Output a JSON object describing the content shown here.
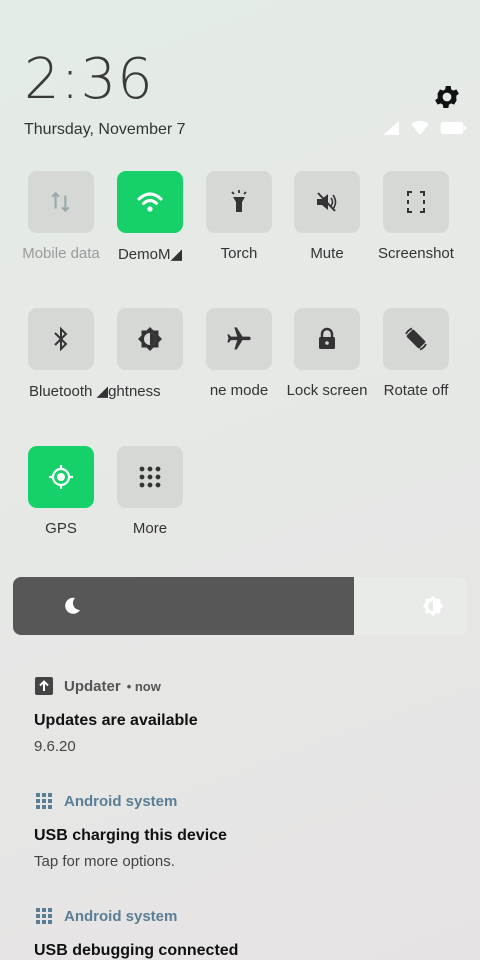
{
  "header": {
    "time": "2:36",
    "date": "Thursday, November 7"
  },
  "tiles": [
    {
      "label": "Mobile data",
      "icon": "mobile-data-icon",
      "on": false
    },
    {
      "label": "DemoM◢",
      "icon": "wifi-icon",
      "on": true
    },
    {
      "label": "Torch",
      "icon": "torch-icon",
      "on": false
    },
    {
      "label": "Mute",
      "icon": "mute-icon",
      "on": false
    },
    {
      "label": "Screenshot",
      "icon": "screenshot-icon",
      "on": false
    },
    {
      "label": "Bluetooth ◢ghtness",
      "icon": "bluetooth-icon",
      "on": false
    },
    {
      "label": "",
      "icon": "brightness-icon",
      "on": false
    },
    {
      "label": "ne mode",
      "icon": "airplane-icon",
      "on": false
    },
    {
      "label": "Lock screen",
      "icon": "lock-icon",
      "on": false
    },
    {
      "label": "Rotate off",
      "icon": "rotate-icon",
      "on": false
    },
    {
      "label": "GPS",
      "icon": "gps-icon",
      "on": true
    },
    {
      "label": "More",
      "icon": "more-icon",
      "on": false
    }
  ],
  "brightness": {
    "level_fraction": 0.75
  },
  "notifications": [
    {
      "app": "Updater",
      "time": "• now",
      "title": "Updates are available",
      "body": "9.6.20"
    },
    {
      "app": "Android system",
      "time": "",
      "title": "USB charging this device",
      "body": "Tap for more options."
    },
    {
      "app": "Android system",
      "time": "",
      "title": "USB debugging connected",
      "body": ""
    }
  ],
  "colors": {
    "accent": "#16d16a",
    "tile_off": "#d5d8d5",
    "app_blue": "#5a7e95"
  }
}
